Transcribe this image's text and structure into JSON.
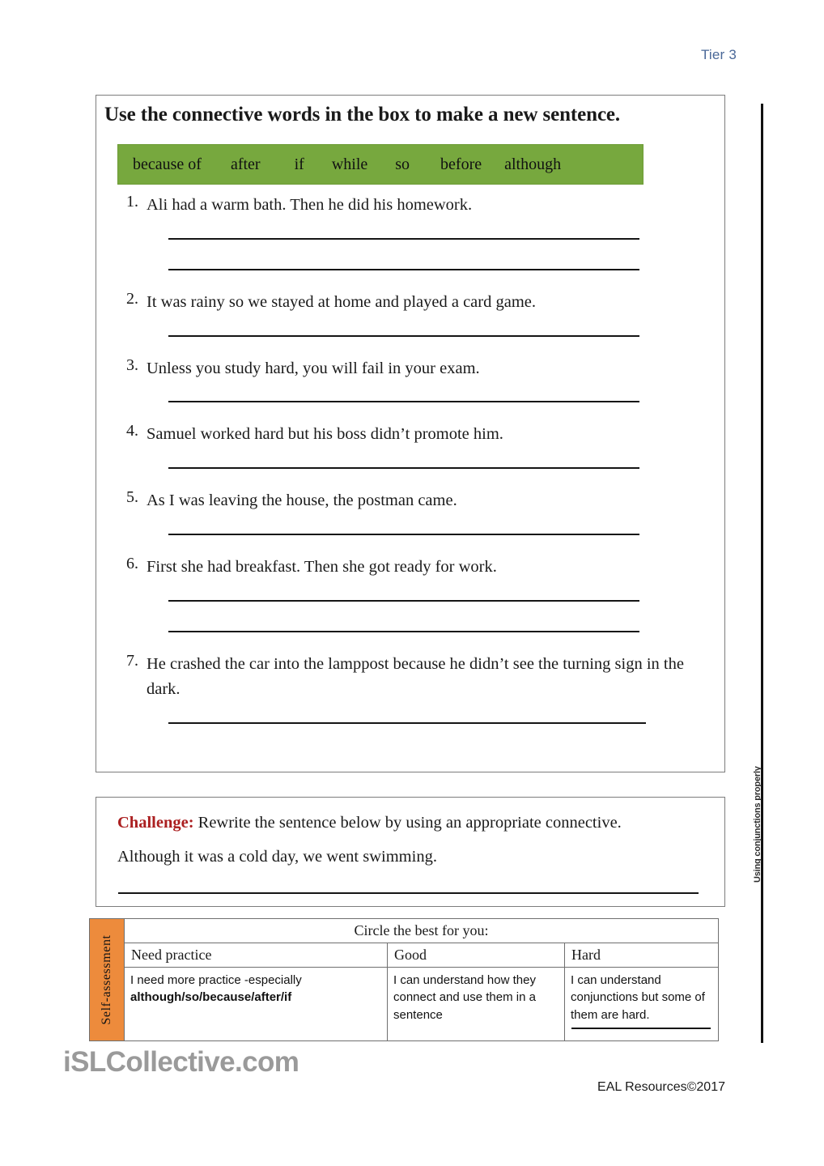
{
  "header": {
    "tier_label": "Tier 3"
  },
  "side": {
    "vertical_text": "Using conjunctions properly"
  },
  "main": {
    "heading": "Use the connective words in the box to make a new sentence.",
    "word_bank": [
      "because of",
      "after",
      "if",
      "while",
      "so",
      "before",
      "although"
    ],
    "questions": [
      {
        "number": "1.",
        "text": "Ali had a warm bath. Then he did his homework.",
        "lines": 2
      },
      {
        "number": "2.",
        "text": "It was rainy so we stayed at home and played a card game.",
        "lines": 1
      },
      {
        "number": "3.",
        "text": "Unless you study hard, you will fail in your exam.",
        "lines": 1
      },
      {
        "number": "4.",
        "text": "Samuel worked hard but his boss didn’t promote him.",
        "lines": 1
      },
      {
        "number": "5.",
        "text": "As I was leaving the house, the postman came.",
        "lines": 1
      },
      {
        "number": "6.",
        "text": "First she had breakfast. Then she got ready for work.",
        "lines": 2
      },
      {
        "number": "7.",
        "text": "He crashed the car into the lamppost because he didn’t see the turning sign in the dark.",
        "lines": 1
      }
    ]
  },
  "challenge": {
    "label": "Challenge:",
    "instruction": " Rewrite the sentence below by using an appropriate connective.",
    "sentence": "Although it was a cold day, we went swimming."
  },
  "self_assessment": {
    "tab_label": "Self-assessment",
    "title": "Circle the best for you:",
    "headers": [
      "Need practice",
      "Good",
      "Hard"
    ],
    "cells": {
      "need_practice_line1": "I need more practice -especially",
      "need_practice_line2": "although/so/because/after/if",
      "good": "I can understand how they connect and use them in a sentence",
      "hard": "I can understand conjunctions but some of them are hard."
    }
  },
  "footer": {
    "watermark": "iSLCollective.com",
    "copyright": "EAL Resources©2017"
  },
  "colors": {
    "word_bank_green": "#77a83e",
    "self_assessment_orange": "#ed8b3c",
    "challenge_red": "#ab1f20",
    "tier_blue": "#4a6898"
  }
}
